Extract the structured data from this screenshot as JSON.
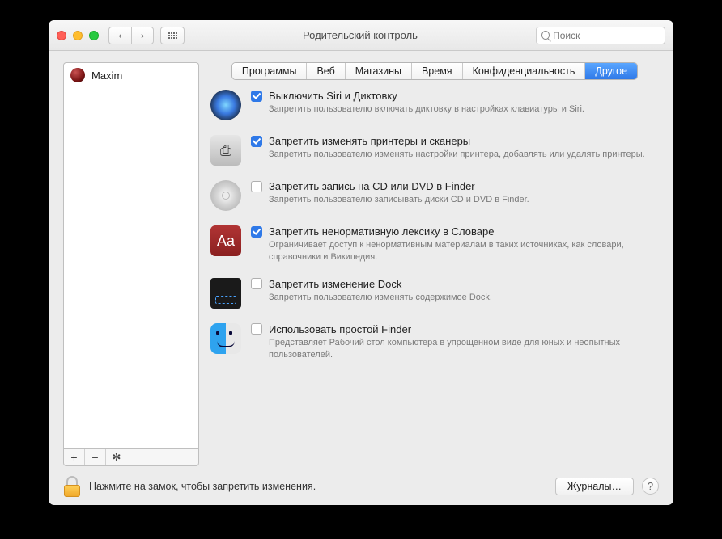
{
  "window": {
    "title": "Родительский контроль",
    "search_placeholder": "Поиск"
  },
  "sidebar": {
    "users": [
      {
        "name": "Maxim"
      }
    ],
    "add_label": "+",
    "remove_label": "−",
    "gear_label": "✻"
  },
  "tabs": [
    {
      "label": "Программы",
      "active": false
    },
    {
      "label": "Веб",
      "active": false
    },
    {
      "label": "Магазины",
      "active": false
    },
    {
      "label": "Время",
      "active": false
    },
    {
      "label": "Конфиденциальность",
      "active": false
    },
    {
      "label": "Другое",
      "active": true
    }
  ],
  "options": [
    {
      "icon": "siri",
      "checked": true,
      "title": "Выключить Siri и Диктовку",
      "desc": "Запретить пользователю включать диктовку в настройках клавиатуры и Siri."
    },
    {
      "icon": "printer",
      "checked": true,
      "title": "Запретить изменять принтеры и сканеры",
      "desc": "Запретить пользователю изменять настройки принтера, добавлять или удалять принтеры."
    },
    {
      "icon": "cd",
      "checked": false,
      "title": "Запретить запись на CD или DVD в Finder",
      "desc": "Запретить пользователю записывать диски CD и DVD в Finder."
    },
    {
      "icon": "dict",
      "dict_glyph": "Aa",
      "checked": true,
      "title": "Запретить ненормативную лексику в Словаре",
      "desc": "Ограничивает доступ к ненормативным материалам в таких источниках, как словари, справочники и Википедия."
    },
    {
      "icon": "dock",
      "checked": false,
      "title": "Запретить изменение Dock",
      "desc": "Запретить пользователю изменять содержимое Dock."
    },
    {
      "icon": "finder",
      "checked": false,
      "title": "Использовать простой Finder",
      "desc": "Представляет Рабочий стол компьютера в упрощенном виде для юных и неопытных пользователей."
    }
  ],
  "footer": {
    "lock_text": "Нажмите на замок, чтобы запретить изменения.",
    "logs_button": "Журналы…",
    "help_glyph": "?"
  },
  "printer_glyph": "⎙"
}
